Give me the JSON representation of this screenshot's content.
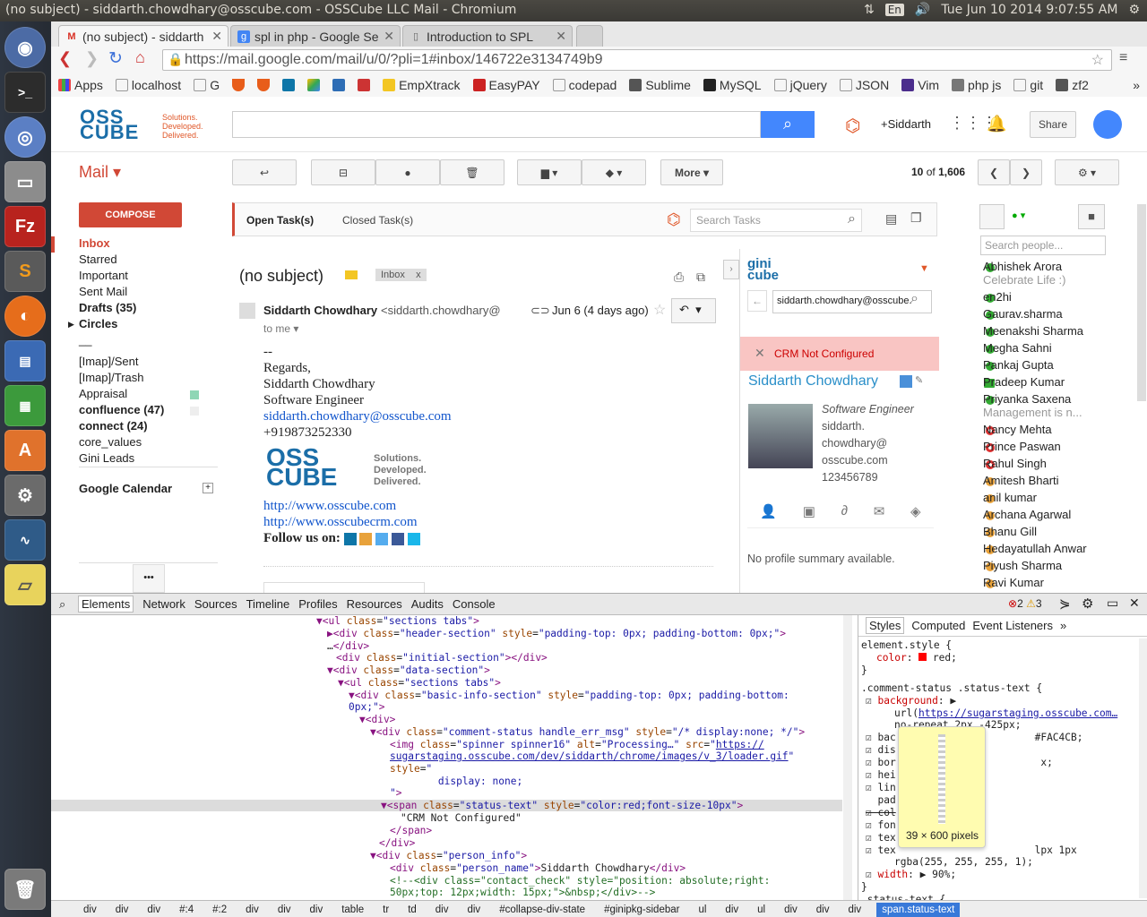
{
  "os": {
    "window_title": "(no subject) - siddarth.chowdhary@osscube.com - OSSCube LLC Mail - Chromium",
    "lang": "En",
    "datetime": "Tue Jun 10 2014  9:07:55 AM"
  },
  "browser": {
    "tabs": [
      {
        "label": "(no subject) - siddarth",
        "active": true
      },
      {
        "label": "spl in php - Google Se",
        "active": false
      },
      {
        "label": "Introduction to SPL",
        "active": false
      }
    ],
    "url": "https://mail.google.com/mail/u/0/?pli=1#inbox/146722e3134749b9",
    "bookmarks": [
      "Apps",
      "localhost",
      "G",
      "",
      "",
      "",
      "",
      "",
      "",
      "",
      "EmpXtrack",
      "EasyPAY",
      "codepad",
      "Sublime",
      "MySQL",
      "jQuery",
      "JSON",
      "Vim",
      "php js",
      "git",
      "zf2"
    ],
    "bookmarks_more": "»"
  },
  "gmail": {
    "logo": "OSS CUBE",
    "logo_tagline": [
      "Solutions.",
      "Developed.",
      "Delivered."
    ],
    "user_link": "+Siddarth",
    "share_label": "Share",
    "mail_label": "Mail",
    "more_label": "More",
    "pagination": {
      "current": "10",
      "of": "of",
      "total": "1,606"
    },
    "compose_label": "COMPOSE",
    "nav": [
      {
        "label": "Inbox",
        "bold": true,
        "red": true
      },
      {
        "label": "Starred"
      },
      {
        "label": "Important"
      },
      {
        "label": "Sent Mail"
      },
      {
        "label": "Drafts (35)",
        "bold": true
      },
      {
        "label": "Circles",
        "bold": true
      },
      {
        "label": "__"
      },
      {
        "label": "[Imap]/Sent"
      },
      {
        "label": "[Imap]/Trash"
      },
      {
        "label": "Appraisal"
      },
      {
        "label": "confluence (47)",
        "bold": true
      },
      {
        "label": "connect (24)",
        "bold": true
      },
      {
        "label": "core_values"
      },
      {
        "label": "Gini Leads"
      }
    ],
    "calendar_label": "Google Calendar",
    "more_dots": "•••",
    "tasks": {
      "open": "Open Task(s)",
      "closed": "Closed Task(s)",
      "search_placeholder": "Search Tasks"
    },
    "message": {
      "subject": "(no subject)",
      "label_tag": "Inbox",
      "label_tag_close": "x",
      "from_name": "Siddarth Chowdhary",
      "from_email": "<siddarth.chowdhary@",
      "date": "Jun 6 (4 days ago)",
      "to": "to me",
      "body": [
        "--",
        "Regards,",
        "Siddarth Chowdhary",
        "Software Engineer"
      ],
      "email_link": "siddarth.chowdhary@osscube.com",
      "phone": "+919873252330",
      "links": [
        "http://www.osscube.com",
        "http://www.osscubecrm.com"
      ],
      "follow": "Follow us on:"
    },
    "gini": {
      "search_value": "siddarth.chowdhary@osscube.",
      "crm_status": "CRM Not Configured",
      "name": "Siddarth Chowdhary",
      "title": "Software Engineer",
      "email_lines": [
        "siddarth.",
        "chowdhary@",
        "osscube.com"
      ],
      "phone": "123456789",
      "summary": "No profile summary available."
    },
    "chat": {
      "search_placeholder": "Search people...",
      "contacts": [
        {
          "name": "Abhishek Arora",
          "status": "online",
          "sub": "Celebrate Life :)"
        },
        {
          "name": "en2hi",
          "status": "online"
        },
        {
          "name": "Gaurav.sharma",
          "status": "online"
        },
        {
          "name": "Meenakshi Sharma",
          "status": "online"
        },
        {
          "name": "Megha Sahni",
          "status": "online"
        },
        {
          "name": "Pankaj Gupta",
          "status": "online"
        },
        {
          "name": "Pradeep Kumar",
          "status": "video"
        },
        {
          "name": "Priyanka Saxena",
          "status": "online",
          "sub": "Management is n..."
        },
        {
          "name": "Nancy Mehta",
          "status": "busy"
        },
        {
          "name": "Prince Paswan",
          "status": "busy"
        },
        {
          "name": "Rahul Singh",
          "status": "busy"
        },
        {
          "name": "Amitesh Bharti",
          "status": "mobile"
        },
        {
          "name": "anil kumar",
          "status": "mobile"
        },
        {
          "name": "Archana Agarwal",
          "status": "mobile"
        },
        {
          "name": "Bhanu Gill",
          "status": "mobile"
        },
        {
          "name": "Hedayatullah Anwar",
          "status": "mobile"
        },
        {
          "name": "Piyush Sharma",
          "status": "away"
        },
        {
          "name": "Ravi Kumar",
          "status": "mobile"
        }
      ]
    }
  },
  "devtools": {
    "tabs": [
      "Elements",
      "Network",
      "Sources",
      "Timeline",
      "Profiles",
      "Resources",
      "Audits",
      "Console"
    ],
    "errors": "2",
    "warnings": "3",
    "styles_tabs": [
      "Styles",
      "Computed",
      "Event Listeners",
      "»"
    ],
    "tooltip": "39 × 600 pixels",
    "breadcrumbs": [
      "div",
      "div",
      "div",
      "#:4",
      "#:2",
      "div",
      "div",
      "div",
      "table",
      "tr",
      "td",
      "div",
      "div",
      "#collapse-div-state",
      "#ginipkg-sidebar",
      "ul",
      "div",
      "ul",
      "div",
      "div",
      "div",
      "span.status-text"
    ]
  }
}
